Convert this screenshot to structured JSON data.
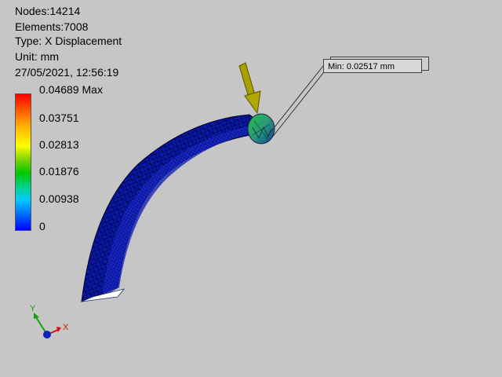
{
  "info": {
    "nodes": "Nodes:14214",
    "elements": "Elements:7008",
    "type": "Type: X Displacement",
    "unit": "Unit: mm",
    "timestamp": "27/05/2021, 12:56:19"
  },
  "legend": {
    "labels": [
      "0.04689 Max",
      "0.03751",
      "0.02813",
      "0.01876",
      "0.00938",
      "0"
    ],
    "colors_top_to_bottom": [
      "#ff0000",
      "#ffa500",
      "#ffff00",
      "#00c800",
      "#00c8ff",
      "#0000ff"
    ]
  },
  "probe": {
    "min_label": "Min: 0.02517 mm"
  },
  "triad": {
    "x_label": "X",
    "y_label": "Y"
  },
  "colors": {
    "background": "#c6c6c6",
    "mesh_blue": "#0a1aa8",
    "load_arrow": "#a8a000"
  }
}
